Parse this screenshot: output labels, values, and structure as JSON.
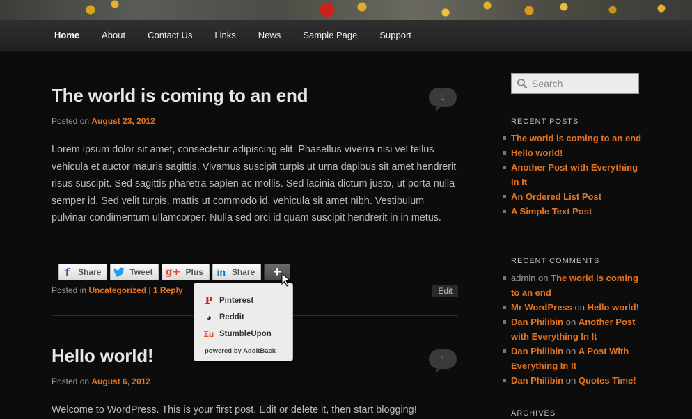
{
  "nav": {
    "items": [
      "Home",
      "About",
      "Contact Us",
      "Links",
      "News",
      "Sample Page",
      "Support"
    ],
    "active": "Home"
  },
  "posts": [
    {
      "title": "The world is coming to an end",
      "posted_prefix": "Posted on",
      "date": "August 23, 2012",
      "comments": "1",
      "body": "Lorem ipsum dolor sit amet, consectetur adipiscing elit. Phasellus viverra nisi vel tellus vehicula et auctor mauris sagittis. Vivamus suscipit turpis ut urna dapibus sit amet hendrerit risus suscipit. Sed sagittis pharetra sapien ac mollis. Sed lacinia dictum justo, ut porta nulla semper id. Sed velit turpis, mattis ut commodo id, vehicula sit amet nibh. Vestibulum pulvinar condimentum ullamcorper. Nulla sed orci id quam suscipit hendrerit in in metus.",
      "posted_in": "Posted in",
      "category": "Uncategorized",
      "separator": "|",
      "reply": "1 Reply",
      "edit": "Edit"
    },
    {
      "title": "Hello world!",
      "posted_prefix": "Posted on",
      "date": "August 6, 2012",
      "comments": "1",
      "body": "Welcome to WordPress. This is your first post. Edit or delete it, then start blogging!"
    }
  ],
  "share": {
    "buttons": [
      {
        "label": "Share",
        "icon": "facebook-icon",
        "glyph": "f",
        "color": "#3b5998"
      },
      {
        "label": "Tweet",
        "icon": "twitter-icon",
        "glyph": "t",
        "color": "#1da1f2"
      },
      {
        "label": "Plus",
        "icon": "google-plus-icon",
        "glyph": "g+",
        "color": "#dd4b39"
      },
      {
        "label": "Share",
        "icon": "linkedin-icon",
        "glyph": "in",
        "color": "#0077b5"
      }
    ],
    "more_glyph": "+"
  },
  "popup": {
    "items": [
      {
        "label": "Pinterest",
        "icon": "pinterest-icon",
        "glyph": "P",
        "color": "#cb2027"
      },
      {
        "label": "Reddit",
        "icon": "reddit-icon",
        "glyph": "◕",
        "color": "#333333"
      },
      {
        "label": "StumbleUpon",
        "icon": "stumbleupon-icon",
        "glyph": "Ʃu",
        "color": "#eb4924"
      }
    ],
    "powered": "powered by AddItBack"
  },
  "sidebar": {
    "search_placeholder": "Search",
    "recent_posts_title": "RECENT POSTS",
    "recent_posts": [
      "The world is coming to an end",
      "Hello world!",
      "Another Post with Everything In It",
      "An Ordered List Post",
      "A Simple Text Post"
    ],
    "recent_comments_title": "RECENT COMMENTS",
    "recent_comments": [
      {
        "author": "admin",
        "linked": false,
        "on": "on",
        "post": "The world is coming to an end"
      },
      {
        "author": "Mr WordPress",
        "linked": true,
        "on": "on",
        "post": "Hello world!"
      },
      {
        "author": "Dan Philibin",
        "linked": true,
        "on": "on",
        "post": "Another Post with Everything In It"
      },
      {
        "author": "Dan Philibin",
        "linked": true,
        "on": "on",
        "post": "A Post With Everything In It"
      },
      {
        "author": "Dan Philibin",
        "linked": true,
        "on": "on",
        "post": "Quotes Time!"
      }
    ],
    "archives_title": "ARCHIVES"
  },
  "colors": {
    "accent": "#e4741f",
    "background": "#0c0c0c"
  }
}
